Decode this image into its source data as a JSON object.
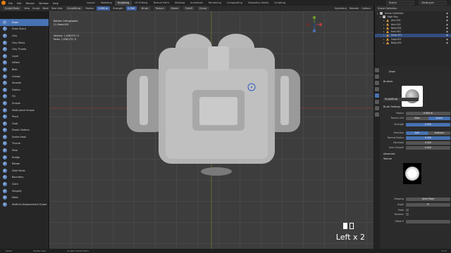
{
  "app": {
    "menu": [
      "File",
      "Edit",
      "Render",
      "Window",
      "Help"
    ],
    "workspaces": [
      "Layout",
      "Modeling",
      "Sculpting",
      "UV Editing",
      "Texture Paint",
      "Shading",
      "Animation",
      "Rendering",
      "Compositing",
      "Geometry Nodes",
      "Scripting"
    ],
    "active_workspace": "Sculpting",
    "scene": "Scene",
    "view_layer": "ViewLayer"
  },
  "toolbar": {
    "mode": "Sculpt Mode",
    "view": "View",
    "sculpt": "Sculpt",
    "mask": "Mask",
    "face_sets": "Face Sets",
    "brush_name": "SculptDraw",
    "radius_label": "Radius",
    "radius_value": "0.905 m",
    "strength_label": "Strength",
    "strength_value": "0.500",
    "brush_menu": "Brush",
    "texture_menu": "Texture",
    "stroke_menu": "Stroke",
    "falloff_menu": "Falloff",
    "cursor_menu": "Cursor",
    "symmetry": "Symmetry",
    "remesh": "Remesh",
    "options": "Options"
  },
  "brushes": [
    "Draw",
    "Draw Sharp",
    "Clay",
    "Clay Strips",
    "Clay Thumb",
    "Layer",
    "Inflate",
    "Blob",
    "Crease",
    "Smooth",
    "Flatten",
    "Fill",
    "Scrape",
    "Multi-plane Scrape",
    "Pinch",
    "Grab",
    "Elastic Deform",
    "Snake Hook",
    "Thumb",
    "Pose",
    "Nudge",
    "Rotate",
    "Slide Relax",
    "Boundary",
    "Cloth",
    "Simplify",
    "Mask",
    "Multires Displacement Eraser"
  ],
  "active_brush": "Draw",
  "viewport": {
    "view_name": "Bottom Orthographic",
    "object_name": "(1) Head.001",
    "vertices_label": "Vertices",
    "vertices_value": "1,038,575 / 0",
    "faces_label": "Faces",
    "faces_value": "1,038,573 / 0",
    "key_hint": "Left x 2"
  },
  "outliner": {
    "title": "Scene Collection",
    "rows": [
      {
        "label": "Scene Collection",
        "type": "collection",
        "selected": false
      },
      {
        "label": "High Poly",
        "type": "collection",
        "selected": false
      },
      {
        "label": "Arm.001",
        "type": "mesh",
        "selected": false
      },
      {
        "label": "Arm.002",
        "type": "mesh",
        "selected": false
      },
      {
        "label": "Body.001",
        "type": "mesh",
        "selected": false
      },
      {
        "label": "Ears.001",
        "type": "mesh",
        "selected": false
      },
      {
        "label": "Head.001",
        "type": "mesh",
        "selected": true
      },
      {
        "label": "Legs.001",
        "type": "mesh",
        "selected": false
      },
      {
        "label": "Body.002",
        "type": "mesh",
        "selected": false
      }
    ]
  },
  "properties": {
    "header": "Draw",
    "brushes_section": "Brushes",
    "brush_name": "SculptDraw",
    "brush_settings": "Brush Settings",
    "radius_label": "Radius",
    "radius_value": "0.905 m",
    "radius_unit_label": "Radius Unit",
    "radius_unit_view": "View",
    "radius_unit_scene": "Scene",
    "strength_label": "Strength",
    "strength_value": "0.500",
    "direction_label": "Direction",
    "direction_add": "Add",
    "direction_sub": "Subtract",
    "normal_radius_label": "Normal Radius",
    "normal_radius_value": "0.500",
    "hardness_label": "Hardness",
    "hardness_value": "0.000",
    "autosmooth_label": "Auto-Smooth",
    "autosmooth_value": "0.000",
    "advanced": "Advanced",
    "texture": "Texture",
    "mapping_label": "Mapping",
    "mapping_value": "Area Plane",
    "angle_label": "Angle",
    "angle_value": "0°",
    "rake_label": "Rake",
    "random_label": "Random",
    "offset_label": "Offset X"
  },
  "statusbar": {
    "items": [
      "Select",
      "Rotate View",
      "Sculpt Context Menu"
    ],
    "version": "3.0.0"
  },
  "colors": {
    "accent": "#4772b3",
    "orange": "#e87d0d"
  }
}
